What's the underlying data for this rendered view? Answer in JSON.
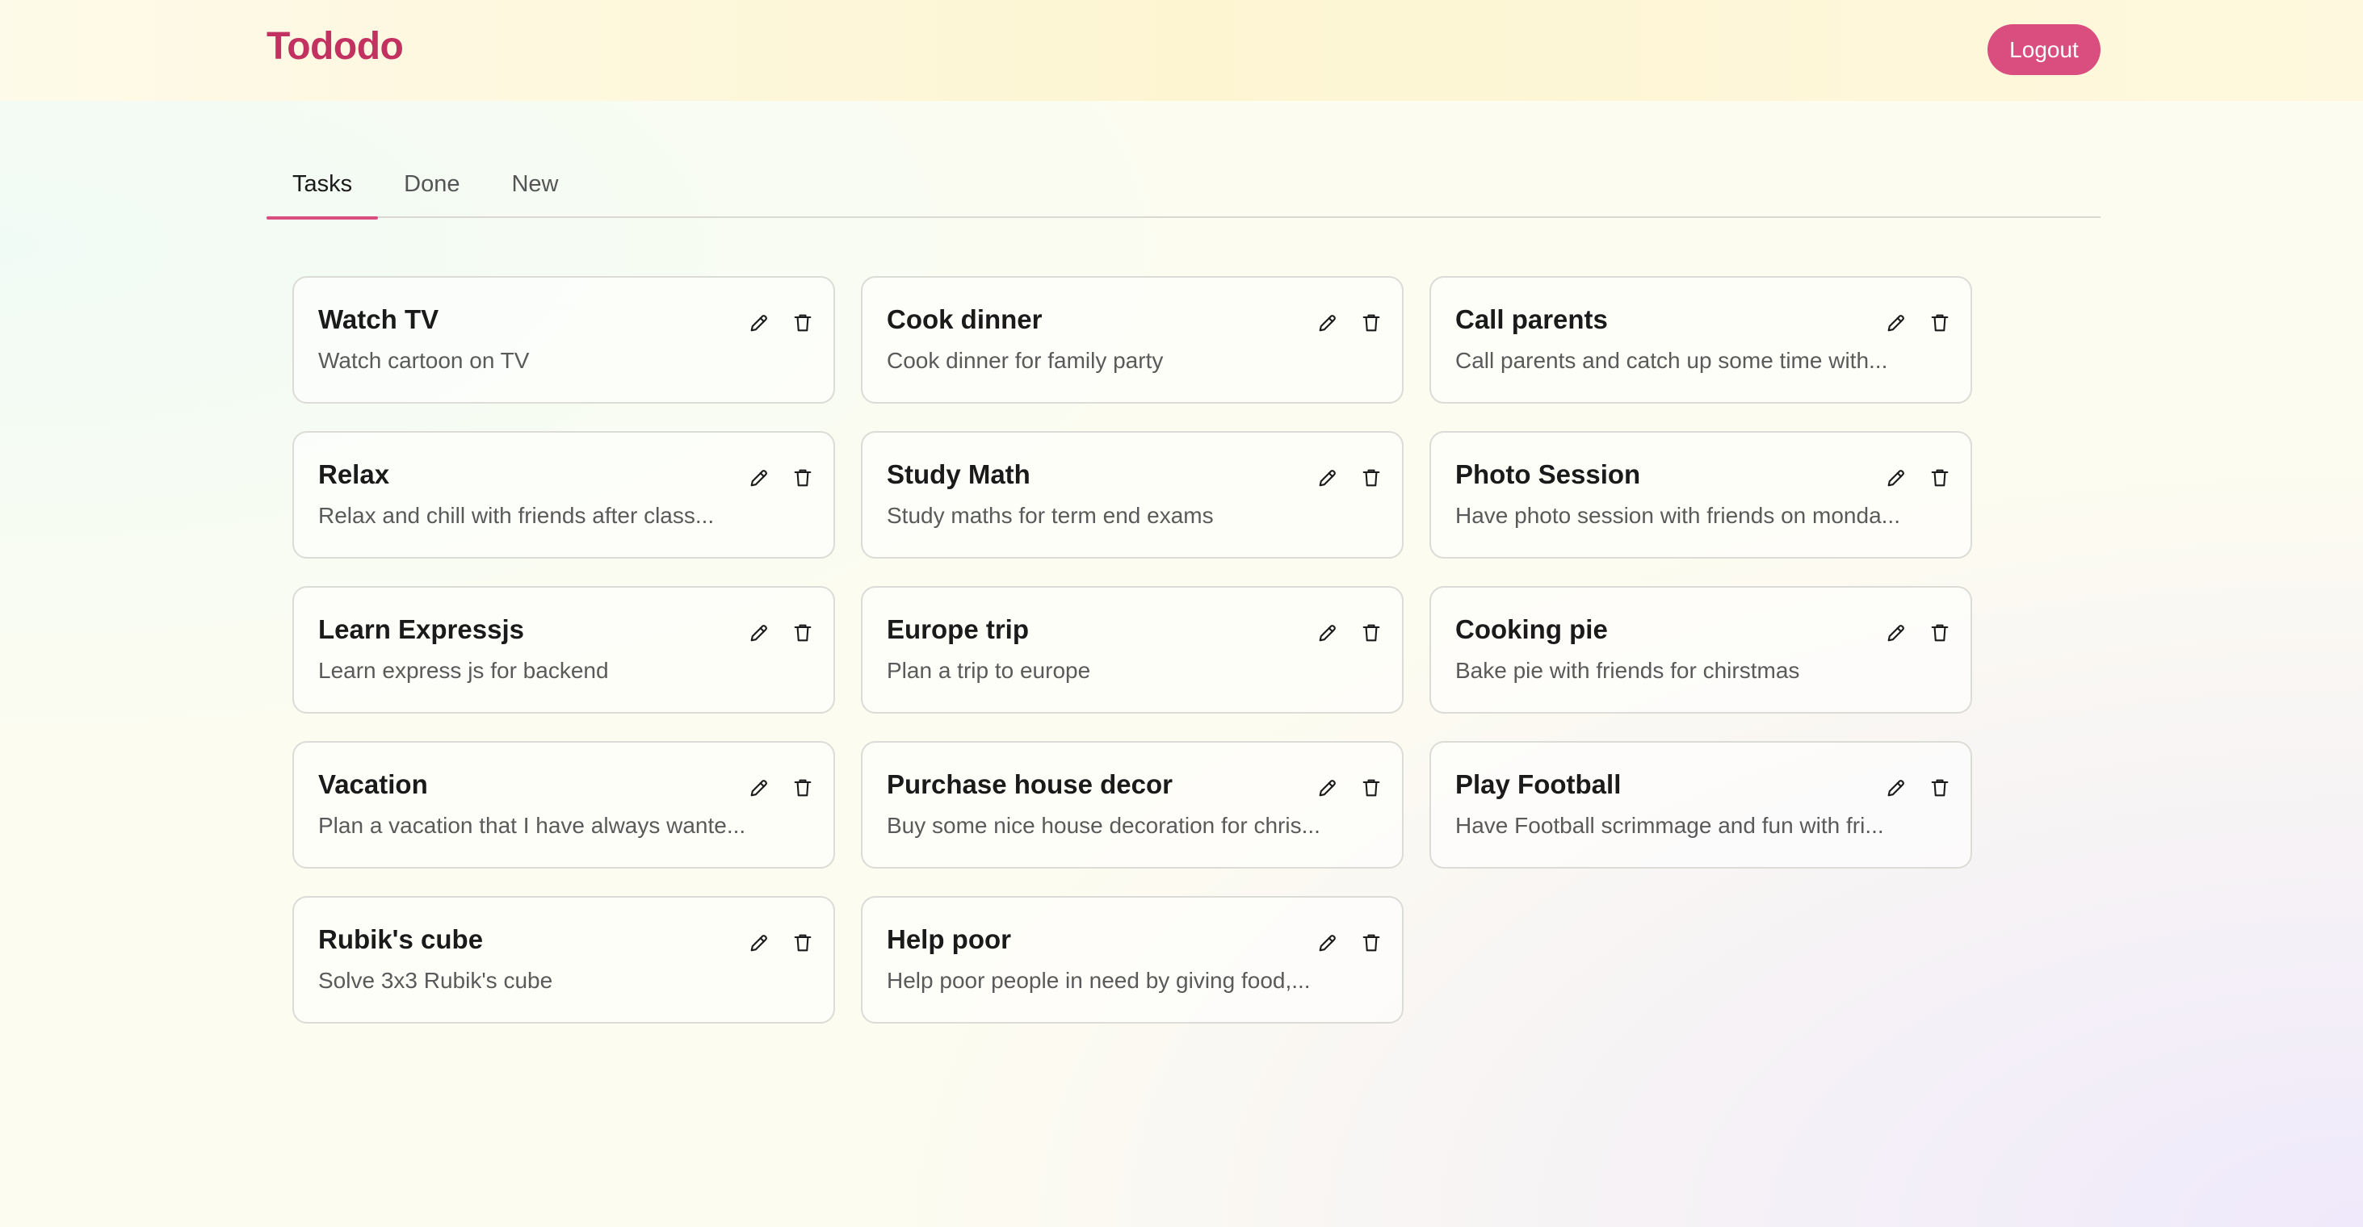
{
  "app": {
    "name": "Tododo",
    "logout_label": "Logout"
  },
  "tabs": [
    {
      "label": "Tasks",
      "active": true
    },
    {
      "label": "Done",
      "active": false
    },
    {
      "label": "New",
      "active": false
    }
  ],
  "colors": {
    "brand": "#c2315f",
    "accent": "#d94e7f"
  },
  "tasks": [
    {
      "title": "Watch TV",
      "description": "Watch cartoon on TV"
    },
    {
      "title": "Cook dinner",
      "description": "Cook dinner for family party"
    },
    {
      "title": "Call parents",
      "description": "Call parents and catch up some time with..."
    },
    {
      "title": "Relax",
      "description": "Relax and chill with friends after class..."
    },
    {
      "title": "Study Math",
      "description": "Study maths for term end exams"
    },
    {
      "title": "Photo Session",
      "description": "Have photo session with friends on monda..."
    },
    {
      "title": "Learn Expressjs",
      "description": "Learn express js for backend"
    },
    {
      "title": "Europe trip",
      "description": "Plan a trip to europe"
    },
    {
      "title": "Cooking pie",
      "description": "Bake pie with friends for chirstmas"
    },
    {
      "title": "Vacation",
      "description": "Plan a vacation that I have always wante..."
    },
    {
      "title": "Purchase house decor",
      "description": "Buy some nice house decoration for chris..."
    },
    {
      "title": "Play Football",
      "description": "Have Football scrimmage and fun with fri..."
    },
    {
      "title": "Rubik's cube",
      "description": "Solve 3x3 Rubik's cube"
    },
    {
      "title": "Help poor",
      "description": "Help poor people in need by giving food,..."
    }
  ],
  "icons": {
    "edit": "pencil-icon",
    "delete": "trash-icon"
  }
}
